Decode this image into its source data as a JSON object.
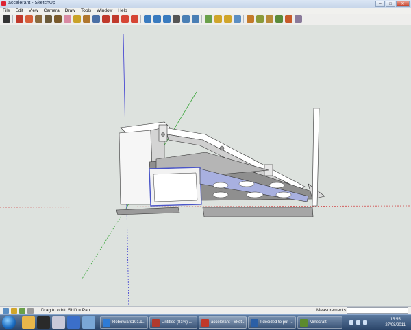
{
  "window": {
    "title": "accelerant - SketchUp",
    "min_label": "–",
    "max_label": "□",
    "close_label": "✕"
  },
  "menu": [
    "File",
    "Edit",
    "View",
    "Camera",
    "Draw",
    "Tools",
    "Window",
    "Help"
  ],
  "toolbar": {
    "tools": [
      {
        "name": "select-tool-icon",
        "color": "#333333"
      },
      {
        "name": "line-tool-icon",
        "color": "#c0392b"
      },
      {
        "name": "pencil-tool-icon",
        "color": "#d65f3a"
      },
      {
        "name": "rectangle-tool-icon",
        "color": "#8a6b3f"
      },
      {
        "name": "circle-tool-icon",
        "color": "#6b5a3a"
      },
      {
        "name": "polygon-tool-icon",
        "color": "#7a5a2b"
      },
      {
        "name": "eraser-tool-icon",
        "color": "#d98aa3"
      },
      {
        "name": "tape-measure-icon",
        "color": "#c9a227"
      },
      {
        "name": "paint-bucket-icon",
        "color": "#b0762d"
      },
      {
        "name": "push-pull-icon",
        "color": "#4a6fa5"
      },
      {
        "name": "move-tool-icon",
        "color": "#c0392b"
      },
      {
        "name": "rotate-tool-icon",
        "color": "#c0392b"
      },
      {
        "name": "follow-me-icon",
        "color": "#d64534"
      },
      {
        "name": "scale-tool-icon",
        "color": "#d64534"
      },
      {
        "name": "offset-tool-icon",
        "color": "#3a7bbf"
      },
      {
        "name": "orbit-tool-icon",
        "color": "#3a7bbf"
      },
      {
        "name": "pan-tool-icon",
        "color": "#3a7bbf"
      },
      {
        "name": "zoom-tool-icon",
        "color": "#555555"
      },
      {
        "name": "zoom-window-icon",
        "color": "#4a7fb5"
      },
      {
        "name": "zoom-extents-icon",
        "color": "#4a7fb5"
      },
      {
        "name": "previous-view-icon",
        "color": "#6aa04a"
      },
      {
        "name": "next-view-icon",
        "color": "#d0a52a"
      },
      {
        "name": "get-models-icon",
        "color": "#d0a52a"
      },
      {
        "name": "share-model-icon",
        "color": "#5b8ec2"
      },
      {
        "name": "components-icon",
        "color": "#c47a2a"
      },
      {
        "name": "add-location-icon",
        "color": "#8a9a3a"
      },
      {
        "name": "toggle-terrain-icon",
        "color": "#b88a3a"
      },
      {
        "name": "preview-google-earth-icon",
        "color": "#5a8a3a"
      },
      {
        "name": "materials-icon",
        "color": "#c75a2a"
      },
      {
        "name": "styles-icon",
        "color": "#8a7a9a"
      }
    ]
  },
  "status": {
    "hint": "Drag to orbit.  Shift = Pan",
    "measurements_label": "Measurements",
    "measurements_value": ""
  },
  "taskbar": {
    "tasks": [
      {
        "label": "Robotwars101.c...",
        "color": "#2e7bd6"
      },
      {
        "label": "Untitled (81%) ...",
        "color": "#b03a2e"
      },
      {
        "label": "accelerant - Sket...",
        "color": "#c0392b"
      },
      {
        "label": "I decided to put ...",
        "color": "#2b5fa6"
      },
      {
        "label": "Minecraft",
        "color": "#5c8a2e"
      }
    ],
    "clock_time": "15:55",
    "clock_date": "27/08/2011"
  },
  "colors": {
    "axis_red": "#d14a4a",
    "axis_green": "#3aa63a",
    "axis_blue": "#3a3ad1",
    "model_face": "#f4f4f4",
    "model_shadow": "#8a8a8a",
    "model_dark": "#444444",
    "model_blue": "#a8b0e0"
  }
}
